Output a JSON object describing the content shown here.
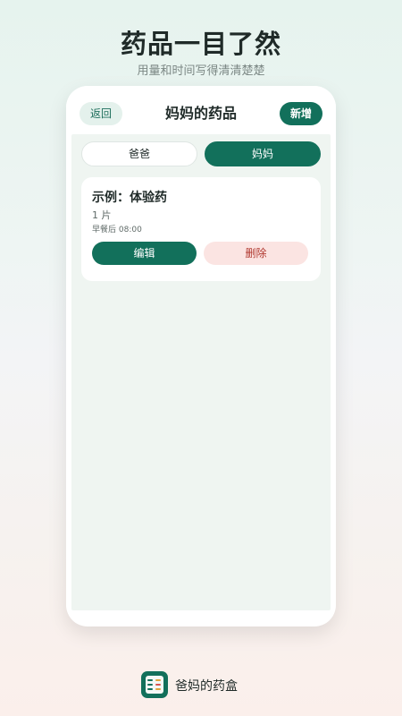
{
  "marketing": {
    "headline": "药品一目了然",
    "subline": "用量和时间写得清清楚楚"
  },
  "screen": {
    "back_label": "返回",
    "title": "妈妈的药品",
    "add_label": "新增"
  },
  "tabs": [
    {
      "label": "爸爸",
      "active": false
    },
    {
      "label": "妈妈",
      "active": true
    }
  ],
  "medicines": [
    {
      "name": "示例：体验药",
      "dose": "1 片",
      "time": "早餐后 08:00",
      "edit_label": "编辑",
      "delete_label": "删除"
    }
  ],
  "footer": {
    "app_name": "爸妈的药盒",
    "icon": "medicine-box-icon"
  },
  "colors": {
    "primary": "#12705b",
    "primary_light": "#e4f1ec",
    "danger_text": "#b0382f",
    "danger_bg": "#fbe4e2"
  }
}
